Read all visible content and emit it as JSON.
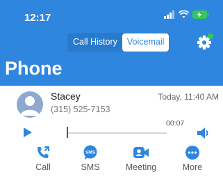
{
  "status_bar": {
    "time": "12:17"
  },
  "tabs": [
    {
      "label": "Call History",
      "active": false
    },
    {
      "label": "Voicemail",
      "active": true
    }
  ],
  "page_title": "Phone",
  "colors": {
    "accent": "#2e86de",
    "battery": "#34c759",
    "badge": "#34c759"
  },
  "voicemail": {
    "name": "Stacey",
    "phone": "(315) 525-7153",
    "datetime": "Today, 11:40 AM",
    "duration": "00:07",
    "progress": 0.0
  },
  "actions": [
    {
      "label": "Call",
      "icon": "phone-icon"
    },
    {
      "label": "SMS",
      "icon": "sms-icon"
    },
    {
      "label": "Meeting",
      "icon": "video-icon"
    },
    {
      "label": "More",
      "icon": "more-icon"
    }
  ],
  "sms_icon_text": "SMS"
}
